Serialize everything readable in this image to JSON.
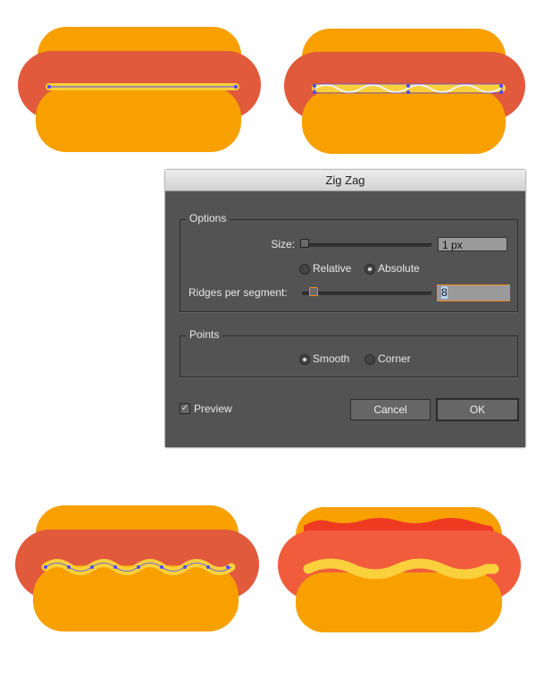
{
  "colors": {
    "bun": "#f7a000",
    "sausage": "#e05a3b",
    "sausage_final": "#f05c3c",
    "mustard": "#fad03c",
    "ketchup": "#ef3a22",
    "path": "#4a4aff"
  },
  "dialog": {
    "title": "Zig Zag",
    "options": {
      "label": "Options",
      "size_label": "Size:",
      "size_value": "1 px",
      "size_slider": 0,
      "relative_label": "Relative",
      "absolute_label": "Absolute",
      "mode": "Absolute",
      "ridges_label": "Ridges per segment:",
      "ridges_value": "8",
      "ridges_slider": 0.08
    },
    "points": {
      "label": "Points",
      "smooth_label": "Smooth",
      "corner_label": "Corner",
      "selected": "Smooth"
    },
    "preview_label": "Preview",
    "preview_checked": true,
    "cancel_label": "Cancel",
    "ok_label": "OK"
  }
}
